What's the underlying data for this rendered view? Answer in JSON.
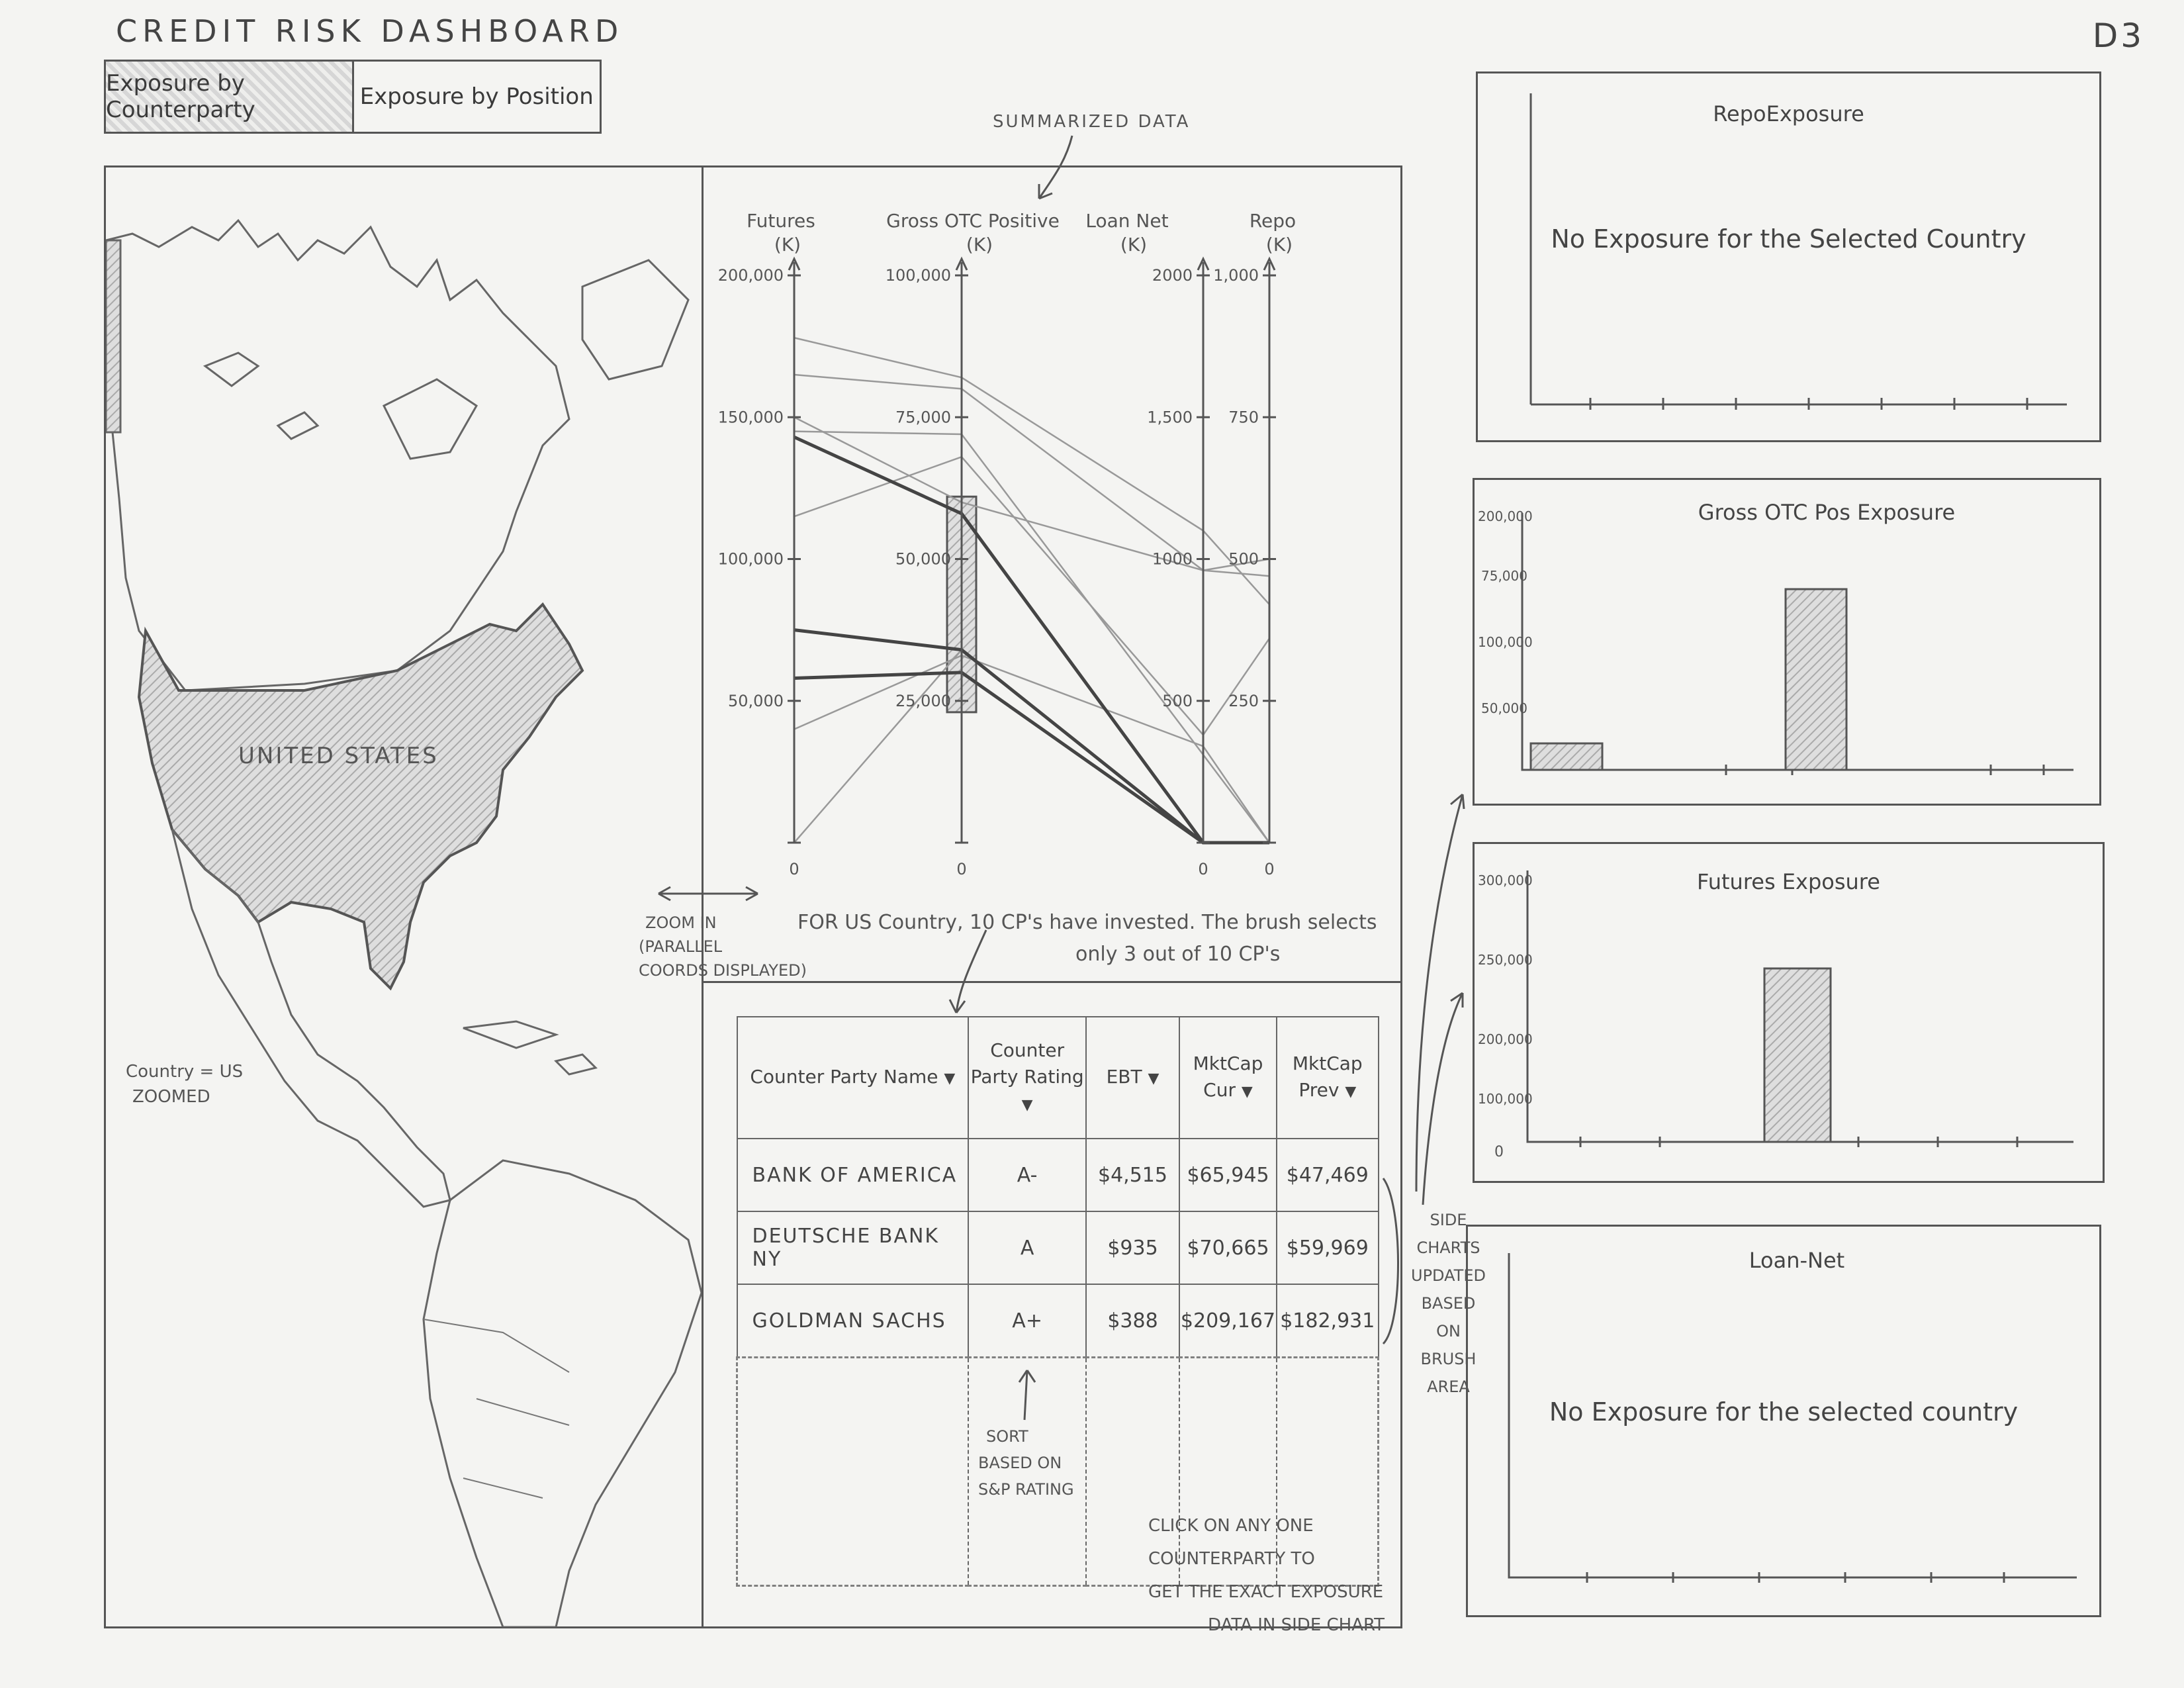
{
  "header": {
    "title": "CREDIT  RISK  DASHBOARD",
    "tag": "D3"
  },
  "tabs": [
    {
      "label": "Exposure by Counterparty",
      "active": true
    },
    {
      "label": "Exposure by Position",
      "active": false
    }
  ],
  "map": {
    "country_label": "UNITED  STATES",
    "side_note": [
      "Country = US",
      "ZOOMED"
    ]
  },
  "parallel_coords": {
    "annotation": "SUMMARIZED DATA",
    "axes": [
      {
        "name": "Futures (K)",
        "ticks": [
          "200,000",
          "150,000",
          "100,000",
          "50,000",
          "0"
        ]
      },
      {
        "name": "Gross OTC Positive (K)",
        "ticks": [
          "100,000",
          "75,000",
          "50,000",
          "25,000",
          "0"
        ]
      },
      {
        "name": "Loan Net (K)",
        "ticks": [
          "2000",
          "1,500",
          "1000",
          "500",
          "0"
        ]
      },
      {
        "name": "Repo (K)",
        "ticks": [
          "1,000",
          "750",
          "500",
          "250",
          "0"
        ]
      }
    ],
    "zoom_note": [
      "ZOOM IN",
      "(PARALLEL",
      "COORDS DISPLAYED)"
    ],
    "brush_note": [
      "FOR US Country, 10 CP's have invested. The brush selects",
      "only 3 out of 10 CP's"
    ]
  },
  "chart_data": {
    "type": "line",
    "title": "SUMMARIZED DATA",
    "axes": [
      "Futures (K)",
      "Gross OTC Positive (K)",
      "Loan Net (K)",
      "Repo (K)"
    ],
    "ranges": [
      [
        0,
        200000
      ],
      [
        0,
        100000
      ],
      [
        0,
        2000
      ],
      [
        0,
        1000
      ]
    ],
    "series": [
      {
        "values": [
          178000,
          82000,
          1100,
          420
        ],
        "highlighted": false
      },
      {
        "values": [
          165000,
          80000,
          960,
          500
        ],
        "highlighted": false
      },
      {
        "values": [
          150000,
          60000,
          960,
          470
        ],
        "highlighted": false
      },
      {
        "values": [
          145000,
          72000,
          310,
          0
        ],
        "highlighted": false
      },
      {
        "values": [
          115000,
          68000,
          380,
          360
        ],
        "highlighted": false
      },
      {
        "values": [
          40000,
          33000,
          340,
          0
        ],
        "highlighted": false
      },
      {
        "values": [
          0,
          34000,
          0,
          0
        ],
        "highlighted": false
      },
      {
        "values": [
          143000,
          58000,
          0,
          0
        ],
        "highlighted": true
      },
      {
        "values": [
          75000,
          34000,
          0,
          0
        ],
        "highlighted": true
      },
      {
        "values": [
          58000,
          30000,
          0,
          0
        ],
        "highlighted": true
      }
    ],
    "brush": {
      "axis": "Gross OTC Positive (K)",
      "range": [
        23000,
        61000
      ]
    }
  },
  "table": {
    "columns": [
      {
        "label": "Counter Party Name"
      },
      {
        "label": "Counter Party Rating"
      },
      {
        "label": "EBT"
      },
      {
        "label": "MktCap Cur"
      },
      {
        "label": "MktCap Prev"
      }
    ],
    "rows": [
      [
        "BANK OF AMERICA",
        "A-",
        "$4,515",
        "$65,945",
        "$47,469"
      ],
      [
        "DEUTSCHE BANK NY",
        "A",
        "$935",
        "$70,665",
        "$59,969"
      ],
      [
        "GOLDMAN SACHS",
        "A+",
        "$388",
        "$209,167",
        "$182,931"
      ]
    ],
    "sort_note": [
      "SORT",
      "BASED ON",
      "S&P RATING"
    ],
    "click_note": [
      "CLICK ON ANY ONE",
      "COUNTERPARTY TO",
      "GET THE EXACT EXPOSURE",
      "DATA IN SIDE CHART"
    ]
  },
  "side_note": [
    "SIDE",
    "CHARTS",
    "UPDATED",
    "BASED",
    "ON",
    "BRUSH",
    "AREA"
  ],
  "side_charts": [
    {
      "title": "RepoExposure",
      "message": "No Exposure for the Selected Country"
    },
    {
      "title": "Gross OTC Pos Exposure",
      "ticks": [
        "200,000",
        "75,000",
        "100,000",
        "50,000"
      ],
      "bars": [
        0.12,
        1.0
      ]
    },
    {
      "title": "Futures Exposure",
      "ticks": [
        "300,000",
        "250,000",
        "200,000",
        "100,000",
        "0"
      ],
      "bars": [
        1.0
      ]
    },
    {
      "title": "Loan-Net",
      "message": "No Exposure for the selected country"
    }
  ]
}
